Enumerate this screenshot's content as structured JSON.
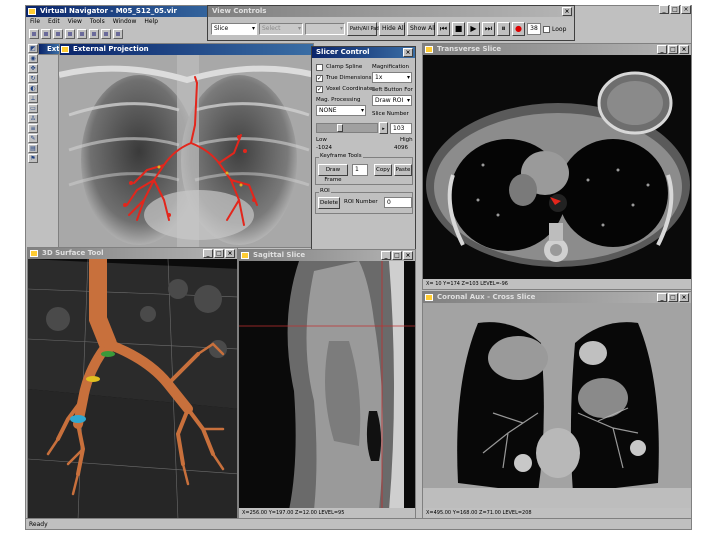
{
  "app": {
    "title": "Virtual Navigator - M05_S12_05.vir",
    "status": "Ready",
    "menu": [
      "File",
      "Edit",
      "View",
      "Tools",
      "Window",
      "Help"
    ]
  },
  "view_controls": {
    "title": "View Controls",
    "mode_select": "Slice",
    "disabled_select": "Select",
    "path_button": "Path/All Path",
    "hide_all": "Hide All",
    "show_all": "Show All",
    "frame_value": "38",
    "loop_label": "Loop"
  },
  "slicer_control": {
    "title": "Slicer Control",
    "clamp_spline": "Clamp Spline",
    "true_dimensions": "True Dimensions",
    "voxel_coordinates": "Voxel Coordinates",
    "magnification_label": "Magnification",
    "magnification_value": "1x",
    "mag_processing_label": "Mag. Processing",
    "mag_processing_value": "NONE",
    "left_button_label": "Left Button For",
    "left_button_value": "Draw ROI",
    "slice_number_label": "Slice Number",
    "slice_number_value": "103",
    "low_label": "Low",
    "low_value": "-1024",
    "high_label": "High",
    "high_value": "4096",
    "keyframe_group": "Keyframe Tools",
    "draw_frame": "Draw Frame",
    "keyframe_value": "1",
    "copy": "Copy",
    "paste": "Paste",
    "roi_group": "ROI",
    "delete": "Delete",
    "roi_number_label": "ROI Number",
    "roi_number_value": "0"
  },
  "panels": {
    "external": "External",
    "external_projection": "External Projection",
    "transverse_slice": "Transverse Slice",
    "surface_tool": "3D Surface Tool",
    "sagittal_slice": "Sagittal Slice",
    "coronal_slice": "Coronal Aux - Cross Slice"
  },
  "readouts": {
    "transverse": "X= 10  Y=174  Z=103  LEVEL=-96",
    "sagittal": "X=256.00  Y=197.00  Z=12.00  LEVEL=95",
    "coronal": "X=495.00  Y=168.00  Z=71.00  LEVEL=208"
  },
  "colors": {
    "title_active": "#0a246a",
    "title_active_end": "#3a6ea5",
    "airway_red": "#e3261c",
    "airway_tan": "#c8703c",
    "play_red": "#dd0000"
  }
}
